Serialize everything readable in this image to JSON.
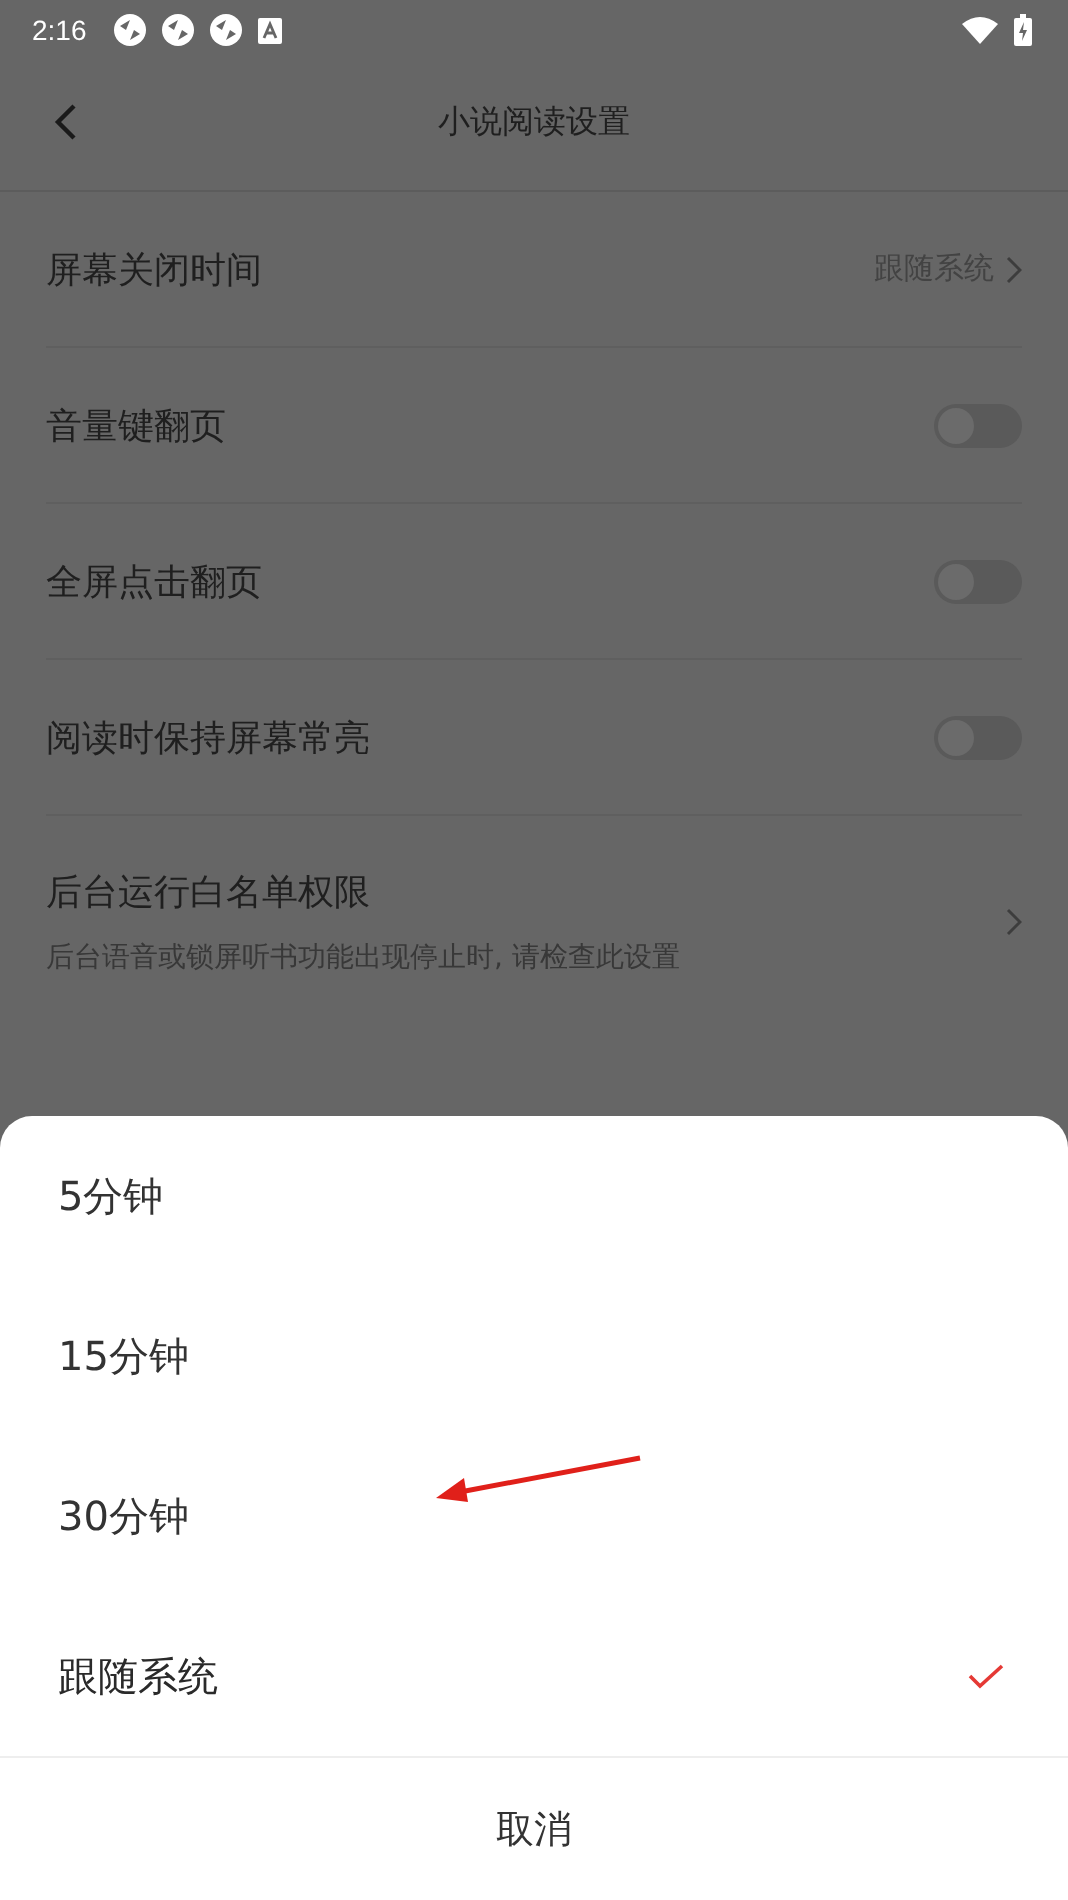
{
  "status_bar": {
    "time": "2:16"
  },
  "header": {
    "title": "小说阅读设置"
  },
  "settings": [
    {
      "kind": "link",
      "label": "屏幕关闭时间",
      "value": "跟随系统"
    },
    {
      "kind": "toggle",
      "label": "音量键翻页",
      "on": false
    },
    {
      "kind": "toggle",
      "label": "全屏点击翻页",
      "on": false
    },
    {
      "kind": "toggle",
      "label": "阅读时保持屏幕常亮",
      "on": false
    },
    {
      "kind": "link",
      "label": "后台运行白名单权限",
      "description": "后台语音或锁屏听书功能出现停止时, 请检查此设置"
    }
  ],
  "sheet": {
    "options": [
      {
        "label": "5分钟",
        "selected": false
      },
      {
        "label": "15分钟",
        "selected": false
      },
      {
        "label": "30分钟",
        "selected": false
      },
      {
        "label": "跟随系统",
        "selected": true
      }
    ],
    "cancel": "取消"
  }
}
